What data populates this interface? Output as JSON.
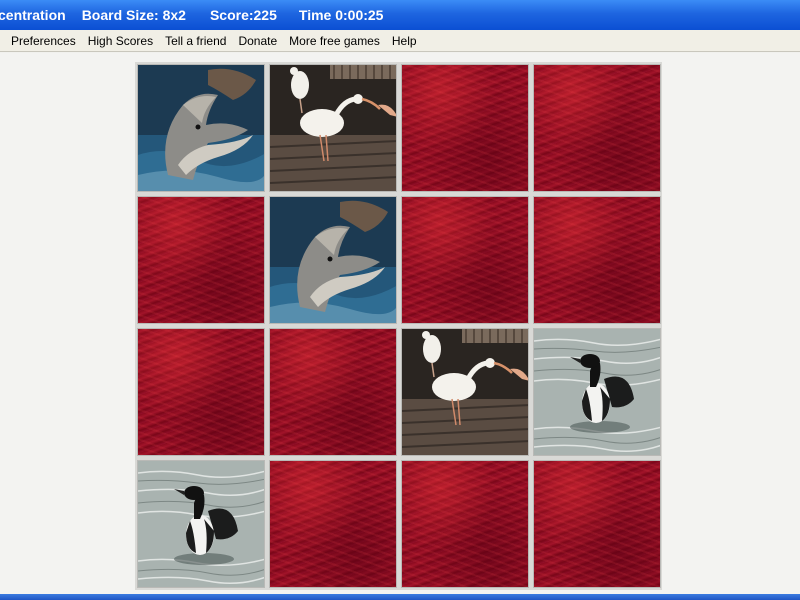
{
  "window": {
    "app_title": "centration",
    "board_size": "Board Size: 8x2",
    "score": "Score:225",
    "time": "Time 0:00:25"
  },
  "menu": {
    "items": [
      "Preferences",
      "High Scores",
      "Tell a friend",
      "Donate",
      "More free games",
      "Help"
    ]
  },
  "board": {
    "rows": 4,
    "cols": 4,
    "cards": [
      [
        "dolphin",
        "ibis",
        "back",
        "back"
      ],
      [
        "back",
        "dolphin",
        "back",
        "back"
      ],
      [
        "back",
        "back",
        "ibis",
        "loon"
      ],
      [
        "loon",
        "back",
        "back",
        "back"
      ]
    ],
    "card_back_color": "#8c0c22"
  }
}
